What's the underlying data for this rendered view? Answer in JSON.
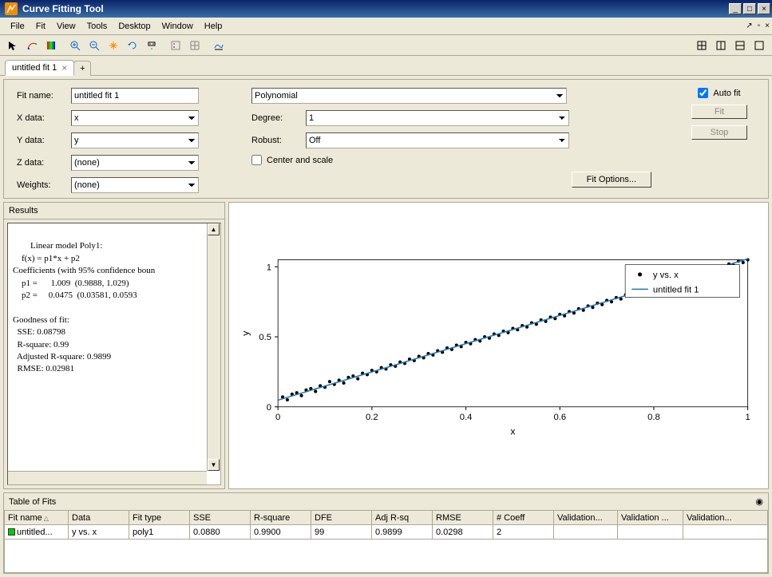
{
  "window": {
    "title": "Curve Fitting Tool"
  },
  "menu": [
    "File",
    "Fit",
    "View",
    "Tools",
    "Desktop",
    "Window",
    "Help"
  ],
  "tabs": {
    "active": "untitled fit 1",
    "add_label": "+"
  },
  "form": {
    "fit_name_lbl": "Fit name:",
    "fit_name_val": "untitled fit 1",
    "xdata_lbl": "X data:",
    "xdata_val": "x",
    "ydata_lbl": "Y data:",
    "ydata_val": "y",
    "zdata_lbl": "Z data:",
    "zdata_val": "(none)",
    "weights_lbl": "Weights:",
    "weights_val": "(none)",
    "fit_type": "Polynomial",
    "degree_lbl": "Degree:",
    "degree_val": "1",
    "robust_lbl": "Robust:",
    "robust_val": "Off",
    "center_scale_lbl": "Center and scale",
    "fit_options_btn": "Fit Options...",
    "auto_fit_lbl": "Auto fit",
    "fit_btn": "Fit",
    "stop_btn": "Stop"
  },
  "results": {
    "head": "Results",
    "text": "Linear model Poly1:\n    f(x) = p1*x + p2\nCoefficients (with 95% confidence boun\n    p1 =      1.009  (0.9888, 1.029)\n    p2 =     0.0475  (0.03581, 0.0593\n\nGoodness of fit:\n  SSE: 0.08798\n  R-square: 0.99\n  Adjusted R-square: 0.9899\n  RMSE: 0.02981"
  },
  "chart_data": {
    "type": "scatter+line",
    "xlabel": "x",
    "ylabel": "y",
    "xlim": [
      0,
      1
    ],
    "ylim": [
      0,
      1.05
    ],
    "xticks": [
      0,
      0.2,
      0.4,
      0.6,
      0.8,
      1
    ],
    "yticks": [
      0,
      0.5,
      1
    ],
    "series": [
      {
        "name": "y vs. x",
        "type": "scatter",
        "color": "#000000",
        "x": [
          0.01,
          0.02,
          0.03,
          0.04,
          0.05,
          0.06,
          0.07,
          0.08,
          0.09,
          0.1,
          0.11,
          0.12,
          0.13,
          0.14,
          0.15,
          0.16,
          0.17,
          0.18,
          0.19,
          0.2,
          0.21,
          0.22,
          0.23,
          0.24,
          0.25,
          0.26,
          0.27,
          0.28,
          0.29,
          0.3,
          0.31,
          0.32,
          0.33,
          0.34,
          0.35,
          0.36,
          0.37,
          0.38,
          0.39,
          0.4,
          0.41,
          0.42,
          0.43,
          0.44,
          0.45,
          0.46,
          0.47,
          0.48,
          0.49,
          0.5,
          0.51,
          0.52,
          0.53,
          0.54,
          0.55,
          0.56,
          0.57,
          0.58,
          0.59,
          0.6,
          0.61,
          0.62,
          0.63,
          0.64,
          0.65,
          0.66,
          0.67,
          0.68,
          0.69,
          0.7,
          0.71,
          0.72,
          0.73,
          0.74,
          0.75,
          0.76,
          0.77,
          0.78,
          0.79,
          0.8,
          0.81,
          0.82,
          0.83,
          0.84,
          0.85,
          0.86,
          0.87,
          0.88,
          0.89,
          0.9,
          0.91,
          0.92,
          0.93,
          0.94,
          0.95,
          0.96,
          0.97,
          0.98,
          0.99,
          1.0
        ],
        "y": [
          0.07,
          0.05,
          0.09,
          0.1,
          0.08,
          0.12,
          0.13,
          0.11,
          0.15,
          0.14,
          0.18,
          0.16,
          0.19,
          0.17,
          0.21,
          0.22,
          0.2,
          0.24,
          0.23,
          0.26,
          0.25,
          0.28,
          0.27,
          0.3,
          0.29,
          0.32,
          0.31,
          0.34,
          0.33,
          0.36,
          0.35,
          0.38,
          0.37,
          0.4,
          0.39,
          0.42,
          0.41,
          0.44,
          0.43,
          0.46,
          0.45,
          0.48,
          0.47,
          0.5,
          0.49,
          0.52,
          0.51,
          0.54,
          0.53,
          0.56,
          0.55,
          0.58,
          0.57,
          0.6,
          0.59,
          0.62,
          0.61,
          0.64,
          0.63,
          0.66,
          0.65,
          0.68,
          0.67,
          0.7,
          0.69,
          0.72,
          0.71,
          0.74,
          0.73,
          0.76,
          0.75,
          0.78,
          0.77,
          0.8,
          0.79,
          0.82,
          0.81,
          0.84,
          0.83,
          0.86,
          0.85,
          0.88,
          0.87,
          0.9,
          0.89,
          0.92,
          0.91,
          0.94,
          0.93,
          0.96,
          0.95,
          0.98,
          0.97,
          1.0,
          0.99,
          1.02,
          1.01,
          1.04,
          1.03,
          1.05
        ]
      },
      {
        "name": "untitled fit 1",
        "type": "line",
        "color": "#1f77b4",
        "x": [
          0,
          1
        ],
        "y": [
          0.0475,
          1.0565
        ]
      }
    ],
    "legend_position": "top-right"
  },
  "fits_panel": {
    "head": "Table of Fits",
    "columns": [
      "Fit name",
      "Data",
      "Fit type",
      "SSE",
      "R-square",
      "DFE",
      "Adj R-sq",
      "RMSE",
      "# Coeff",
      "Validation...",
      "Validation ...",
      "Validation..."
    ],
    "rows": [
      {
        "fitname": "untitled...",
        "data": "y vs. x",
        "fittype": "poly1",
        "sse": "0.0880",
        "r2": "0.9900",
        "dfe": "99",
        "adjr2": "0.9899",
        "rmse": "0.0298",
        "ncoeff": "2",
        "v1": "",
        "v2": "",
        "v3": ""
      }
    ]
  }
}
